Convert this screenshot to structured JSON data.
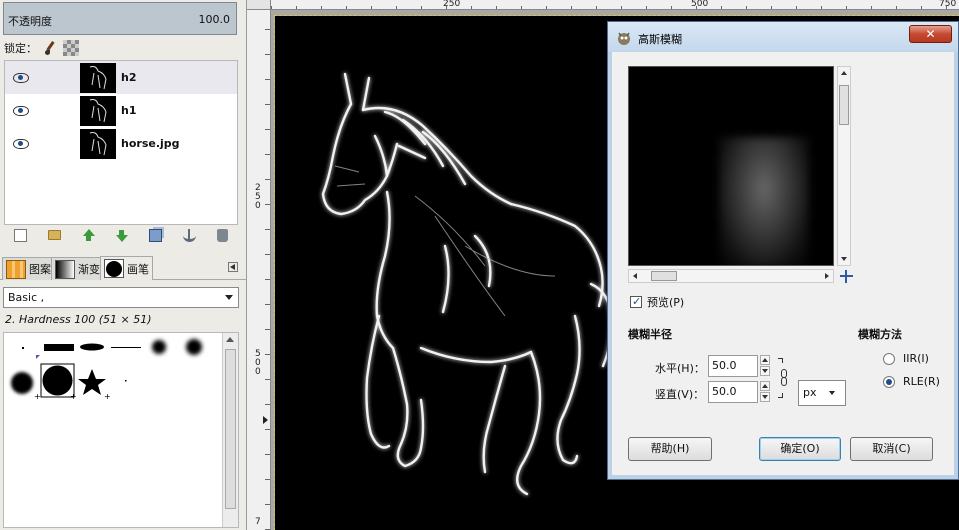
{
  "layers_panel": {
    "opacity_label": "不透明度",
    "opacity_value": "100.0",
    "lock_label": "锁定：",
    "layers": [
      {
        "name": "h2",
        "selected": true
      },
      {
        "name": "h1",
        "selected": false
      },
      {
        "name": "horse.jpg",
        "selected": false
      }
    ]
  },
  "brushes_panel": {
    "tabs": [
      "图案",
      "渐变",
      "画笔"
    ],
    "preset": "Basic ,",
    "brush_description": "2. Hardness 100 (51 × 51)"
  },
  "rulers": {
    "top": [
      "250",
      "500",
      "750"
    ],
    "left": [
      "250",
      "500",
      "7"
    ]
  },
  "dialog": {
    "title": "高斯模糊",
    "close_label": "✕",
    "preview_label": "预览(P)",
    "preview_checked": true,
    "blur_radius_title": "模糊半径",
    "horizontal_label": "水平(H)：",
    "horizontal_value": "50.0",
    "vertical_label": "竖直(V)：",
    "vertical_value": "50.0",
    "unit": "px",
    "blur_method_title": "模糊方法",
    "methods": [
      {
        "label": "IIR(I)",
        "selected": false
      },
      {
        "label": "RLE(R)",
        "selected": true
      }
    ],
    "help_label": "帮助(H)",
    "ok_label": "确定(O)",
    "cancel_label": "取消(C)"
  },
  "colors": {
    "selection_dash": "#d8c838",
    "dialog_border": "#4f6f92",
    "close_red": "#c54a32"
  }
}
